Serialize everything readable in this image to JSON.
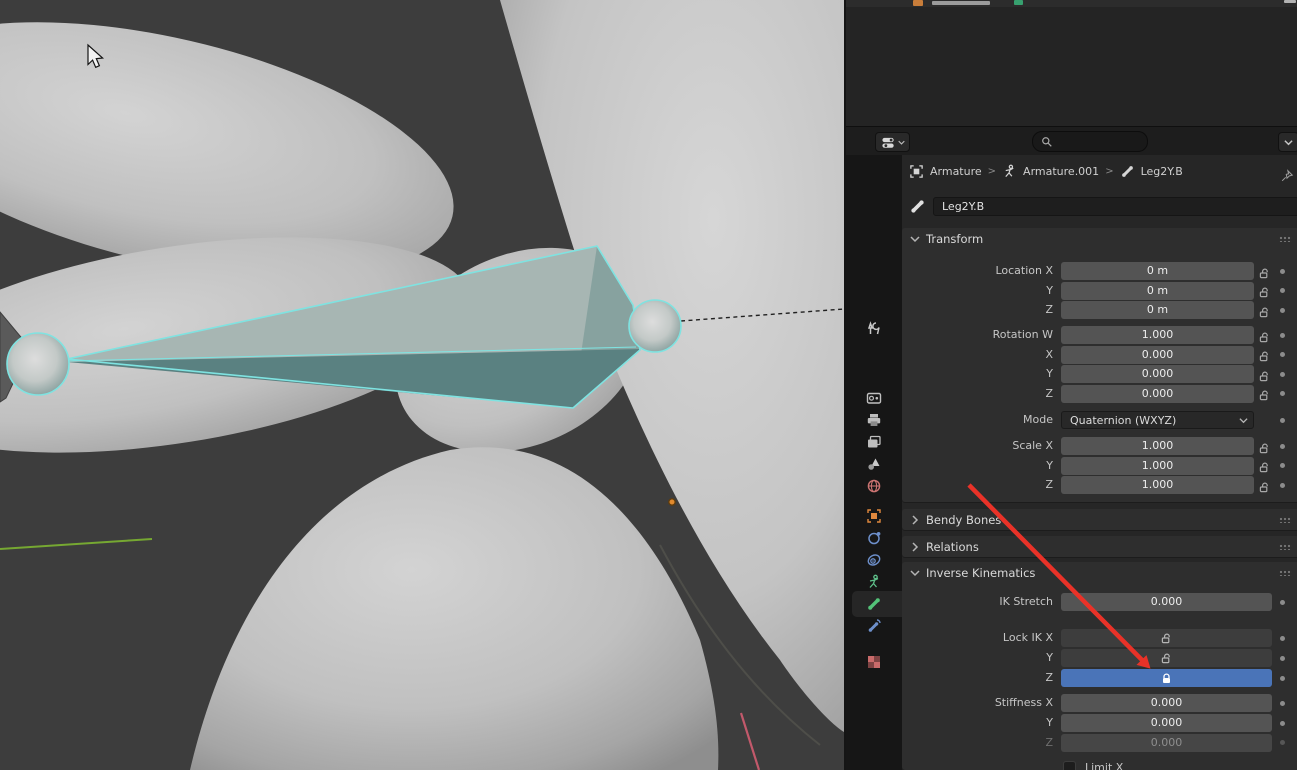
{
  "header": {
    "search_placeholder": ""
  },
  "breadcrumb": {
    "separator": ">",
    "items": [
      "Armature",
      "Armature.001",
      "Leg2Y.B"
    ]
  },
  "bone_name_field": {
    "value": "Leg2Y.B"
  },
  "panels": {
    "transform": {
      "title": "Transform",
      "rows": {
        "loc_x": {
          "label": "Location X",
          "value": "0 m"
        },
        "loc_y": {
          "label": "Y",
          "value": "0 m"
        },
        "loc_z": {
          "label": "Z",
          "value": "0 m"
        },
        "rot_w": {
          "label": "Rotation W",
          "value": "1.000"
        },
        "rot_x": {
          "label": "X",
          "value": "0.000"
        },
        "rot_y": {
          "label": "Y",
          "value": "0.000"
        },
        "rot_z": {
          "label": "Z",
          "value": "0.000"
        },
        "mode": {
          "label": "Mode",
          "value": "Quaternion (WXYZ)"
        },
        "scale_x": {
          "label": "Scale X",
          "value": "1.000"
        },
        "scale_y": {
          "label": "Y",
          "value": "1.000"
        },
        "scale_z": {
          "label": "Z",
          "value": "1.000"
        }
      }
    },
    "bendy_bones": {
      "title": "Bendy Bones"
    },
    "relations": {
      "title": "Relations"
    },
    "inverse_kinematics": {
      "title": "Inverse Kinematics",
      "ik_stretch": {
        "label": "IK Stretch",
        "value": "0.000"
      },
      "lock_ik": {
        "label_x": "Lock IK X",
        "label_y": "Y",
        "label_z": "Z",
        "x_locked": false,
        "y_locked": false,
        "z_locked": true
      },
      "stiffness": {
        "label_x": "Stiffness X",
        "label_y": "Y",
        "label_z": "Z",
        "x": "0.000",
        "y": "0.000",
        "z": "0.000",
        "z_disabled": true
      },
      "limit_x_label": "Limit X"
    }
  },
  "colors": {
    "accent_blue": "#4a74b8",
    "annotation_arrow_red": "#e93228",
    "bone_select_cyan": "#7fe3e1",
    "axis_green": "#76a832",
    "origin_orange": "#e18a2e"
  }
}
